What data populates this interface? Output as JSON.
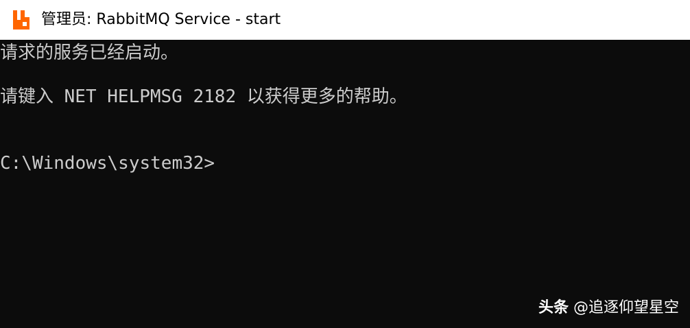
{
  "window": {
    "title": "管理员: RabbitMQ Service - start",
    "icon": "rabbitmq-icon",
    "accent_color": "#ff6600"
  },
  "console": {
    "lines": [
      "请求的服务已经启动。",
      "请键入 NET HELPMSG 2182 以获得更多的帮助。",
      "C:\\Windows\\system32>"
    ],
    "background_color": "#0c0c0c",
    "text_color": "#cccccc"
  },
  "watermark": {
    "brand": "头条",
    "handle": "@追逐仰望星空"
  }
}
